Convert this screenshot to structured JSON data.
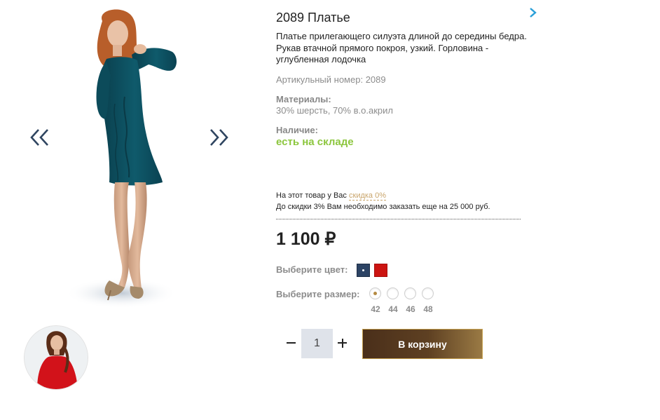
{
  "product": {
    "title": "2089 Платье",
    "description": "Платье прилегающего силуэта длиной до середины бедра. Рукав втачной прямого покроя, узкий. Горловина - углубленная лодочка",
    "sku_label": "Артикульный номер:",
    "sku_value": "2089",
    "materials_label": "Материалы:",
    "materials_value": "30% шерсть, 70% в.о.акрил",
    "stock_label": "Наличие:",
    "stock_value": "есть на складе"
  },
  "discount": {
    "line1_prefix": "На этот товар у Вас",
    "line1_link": "скидка 0%",
    "line2": "До скидки 3% Вам необходимо заказать еще на 25 000 руб."
  },
  "price": "1 100 ₽",
  "color": {
    "label": "Выберите цвет:",
    "options": [
      {
        "name": "navy",
        "hex": "#2c4364",
        "selected": true
      },
      {
        "name": "red",
        "hex": "#cc1411",
        "selected": false
      }
    ]
  },
  "size": {
    "label": "Выберите размер:",
    "options": [
      "42",
      "44",
      "46",
      "48"
    ],
    "selected": "42"
  },
  "quantity": {
    "value": "1"
  },
  "cart_button": "В корзину",
  "colors": {
    "accent_gold": "#c9a56b",
    "stock_green": "#8cc63e",
    "dress_teal": "#0f5566",
    "link_blue": "#2a9fd8"
  },
  "icons": {
    "prev": "double-chevron-left-icon",
    "next": "double-chevron-right-icon",
    "next_product": "chevron-right-icon"
  }
}
